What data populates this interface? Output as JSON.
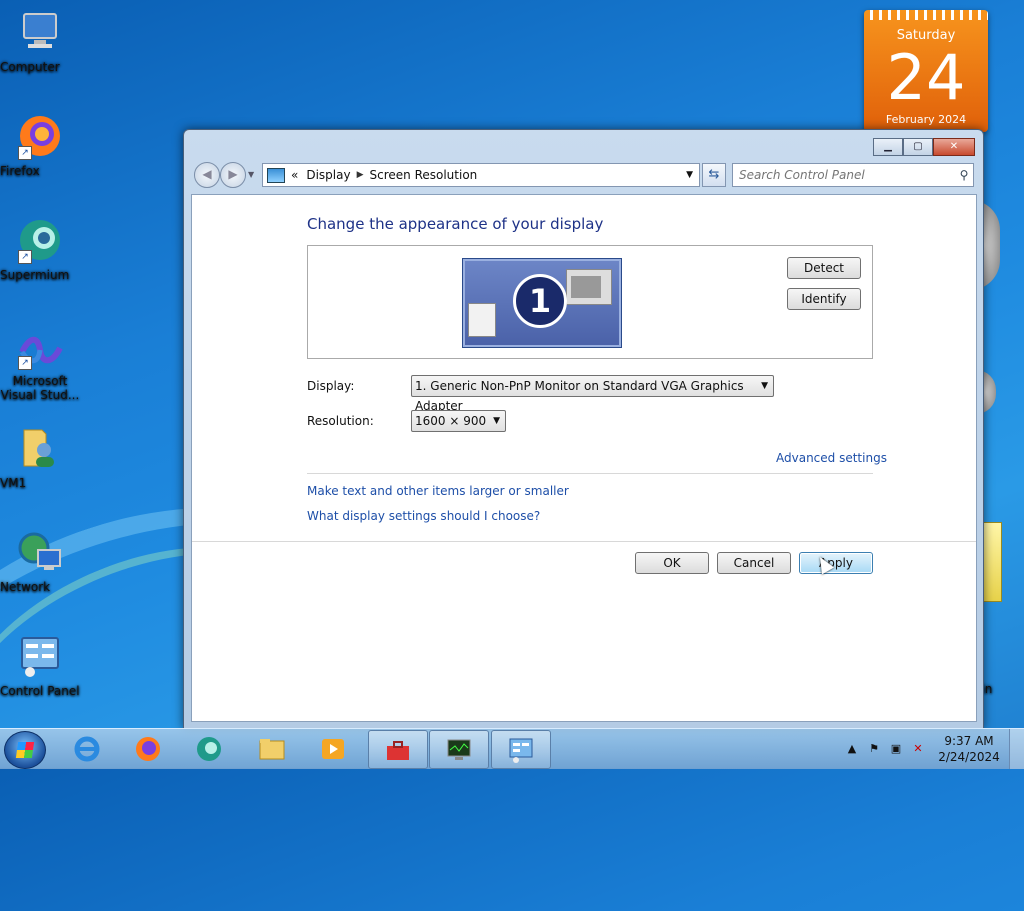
{
  "desktop": {
    "icons": [
      {
        "label": "Computer"
      },
      {
        "label": "Firefox"
      },
      {
        "label": "Supermium"
      },
      {
        "label": "Microsoft Visual Stud..."
      },
      {
        "label": "VM1"
      },
      {
        "label": "Network"
      },
      {
        "label": "Control Panel"
      }
    ],
    "recycle_label": "e Bin"
  },
  "calendar": {
    "weekday": "Saturday",
    "day": "24",
    "month": "February 2024"
  },
  "window": {
    "breadcrumb": {
      "prefix": "«",
      "parent": "Display",
      "current": "Screen Resolution"
    },
    "search_placeholder": "Search Control Panel",
    "heading": "Change the appearance of your display",
    "monitor_number": "1",
    "detect_label": "Detect",
    "identify_label": "Identify",
    "display_label": "Display:",
    "display_value": "1. Generic Non-PnP Monitor on Standard VGA Graphics Adapter",
    "resolution_label": "Resolution:",
    "resolution_value": "1600 × 900",
    "advanced_link": "Advanced settings",
    "link_text_size": "Make text and other items larger or smaller",
    "link_help": "What display settings should I choose?",
    "ok_label": "OK",
    "cancel_label": "Cancel",
    "apply_label": "Apply"
  },
  "taskbar": {
    "clock_time": "9:37 AM",
    "clock_date": "2/24/2024"
  },
  "colors": {
    "accent": "#1e3287",
    "link": "#1e4fa8",
    "calendar": "#e0600a"
  }
}
